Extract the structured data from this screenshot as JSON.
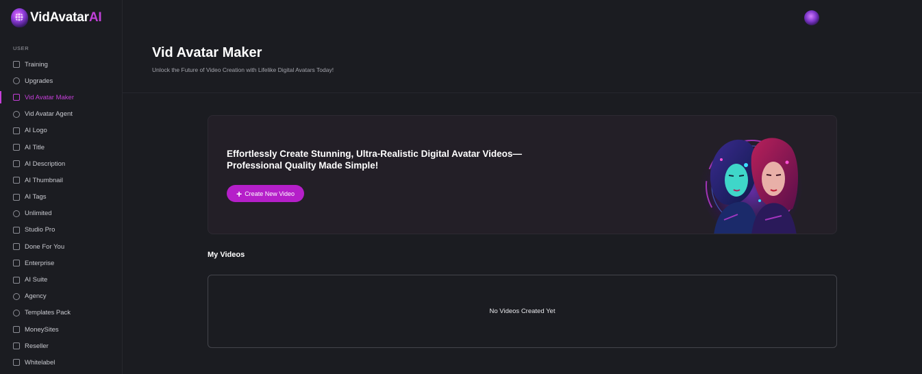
{
  "brand": {
    "name_main": "VidAvatar",
    "name_accent": "AI",
    "accent_color": "#c53fd9"
  },
  "sidebar": {
    "section_label": "USER",
    "items": [
      {
        "label": "Training",
        "icon": "laptop-icon",
        "active": false
      },
      {
        "label": "Upgrades",
        "icon": "refresh-icon",
        "active": false
      },
      {
        "label": "Vid Avatar Maker",
        "icon": "play-icon",
        "active": true
      },
      {
        "label": "Vid Avatar Agent",
        "icon": "chat-icon",
        "active": false
      },
      {
        "label": "AI Logo",
        "icon": "image-icon",
        "active": false
      },
      {
        "label": "AI Title",
        "icon": "document-icon",
        "active": false
      },
      {
        "label": "AI Description",
        "icon": "document-icon",
        "active": false
      },
      {
        "label": "AI Thumbnail",
        "icon": "image-icon",
        "active": false
      },
      {
        "label": "AI Tags",
        "icon": "document-icon",
        "active": false
      },
      {
        "label": "Unlimited",
        "icon": "refresh-icon",
        "active": false
      },
      {
        "label": "Studio Pro",
        "icon": "sliders-icon",
        "active": false
      },
      {
        "label": "Done For You",
        "icon": "checklist-icon",
        "active": false
      },
      {
        "label": "Enterprise",
        "icon": "grid-icon",
        "active": false
      },
      {
        "label": "AI Suite",
        "icon": "pulse-icon",
        "active": false
      },
      {
        "label": "Agency",
        "icon": "users-icon",
        "active": false
      },
      {
        "label": "Templates Pack",
        "icon": "dollar-icon",
        "active": false
      },
      {
        "label": "MoneySites",
        "icon": "laptop-icon",
        "active": false
      },
      {
        "label": "Reseller",
        "icon": "store-icon",
        "active": false
      },
      {
        "label": "Whitelabel",
        "icon": "file-icon",
        "active": false
      }
    ]
  },
  "header": {
    "title": "Vid Avatar Maker",
    "subtitle": "Unlock the Future of Video Creation with Lifelike Digital Avatars Today!"
  },
  "hero": {
    "heading_line1": "Effortlessly Create Stunning, Ultra-Realistic Digital Avatar Videos—",
    "heading_line2": "Professional Quality Made Simple!",
    "button_label": "Create New Video"
  },
  "videos": {
    "title": "My Videos",
    "empty_message": "No Videos Created Yet"
  }
}
